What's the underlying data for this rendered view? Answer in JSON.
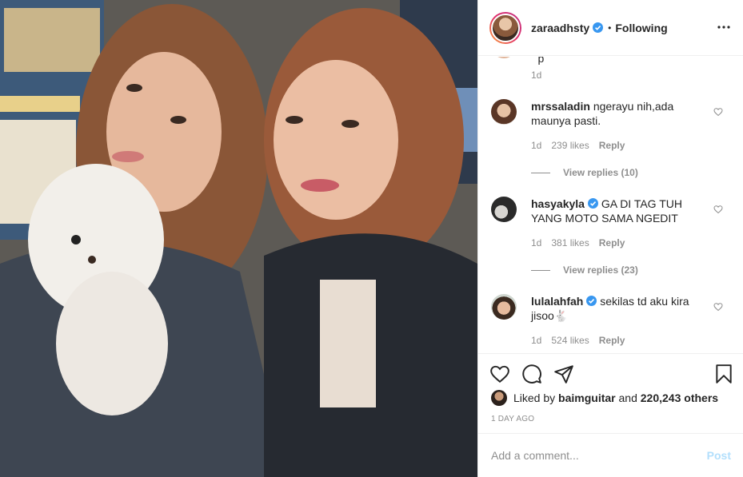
{
  "header": {
    "username": "zaraadhsty",
    "separator": "•",
    "follow_status": "Following"
  },
  "comments": {
    "previous_time": "1d",
    "items": [
      {
        "username": "mrssaladin",
        "text": "ngerayu nih,ada maunya pasti.",
        "time": "1d",
        "likes": "239 likes",
        "reply_label": "Reply",
        "view_replies": "View replies (10)",
        "verified": false
      },
      {
        "username": "hasyakyla",
        "text": "GA DI TAG TUH YANG MOTO SAMA NGEDIT",
        "time": "1d",
        "likes": "381 likes",
        "reply_label": "Reply",
        "view_replies": "View replies (23)",
        "verified": true
      },
      {
        "username": "lulalahfah",
        "text": "sekilas td aku kira jisoo🐇",
        "time": "1d",
        "likes": "524 likes",
        "reply_label": "Reply",
        "verified": true
      }
    ]
  },
  "likes": {
    "prefix": "Liked by",
    "user": "baimguitar",
    "joiner": "and",
    "others": "220,243 others"
  },
  "date": "1 DAY AGO",
  "add_comment": {
    "placeholder": "Add a comment...",
    "post_label": "Post"
  },
  "colors": {
    "verified": "#3897f0",
    "post_disabled": "#b2dffc",
    "muted": "#8e8e8e"
  },
  "icons": [
    "more-options-icon",
    "verified-badge-icon",
    "heart-icon",
    "comment-icon",
    "share-icon",
    "bookmark-icon"
  ]
}
